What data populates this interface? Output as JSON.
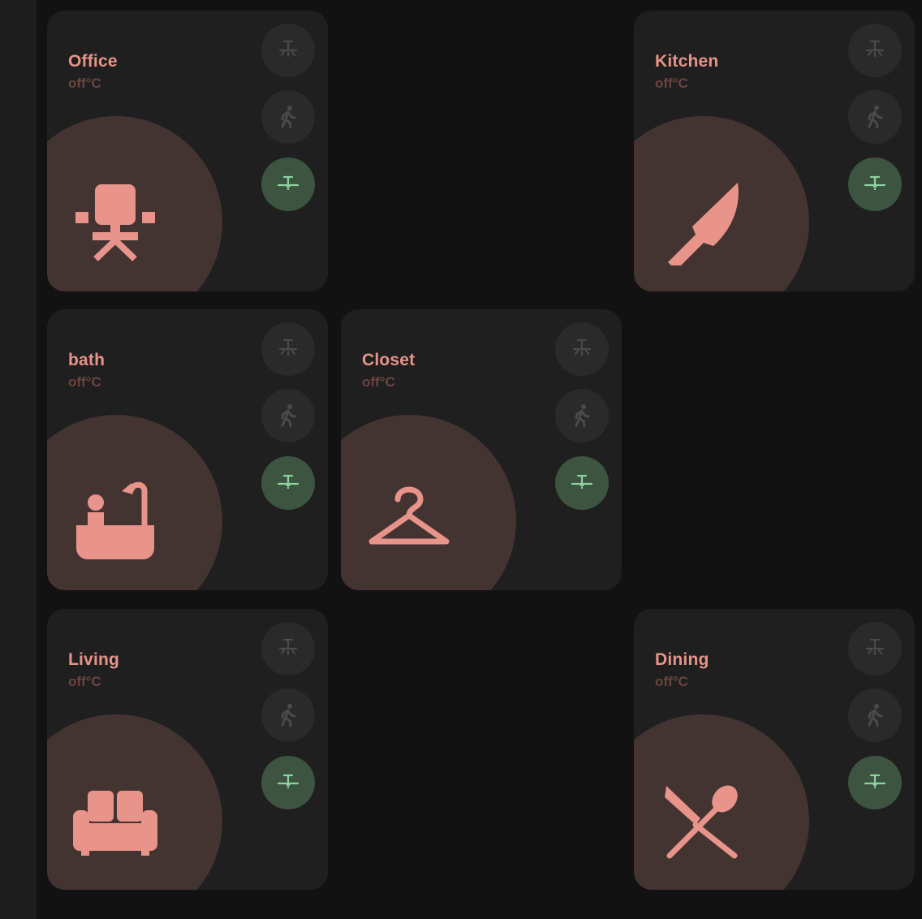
{
  "colors": {
    "accent": "#e8948a",
    "temp": "#6a4540",
    "card": "#1f1f1f",
    "blob": "#433432",
    "button_off": "#2a2a2a",
    "button_on": "#3c5440",
    "icon_on": "#8fd19e",
    "icon_off": "#4a4a4a"
  },
  "rooms": [
    {
      "name": "Office",
      "temp": "off°C",
      "icon": "office-chair-icon"
    },
    {
      "name": "Kitchen",
      "temp": "off°C",
      "icon": "knife-icon"
    },
    {
      "name": "bath",
      "temp": "off°C",
      "icon": "bathtub-icon"
    },
    {
      "name": "Closet",
      "temp": "off°C",
      "icon": "hanger-icon"
    },
    {
      "name": "Living",
      "temp": "off°C",
      "icon": "sofa-icon"
    },
    {
      "name": "Dining",
      "temp": "off°C",
      "icon": "silverware-icon"
    }
  ],
  "buttons": {
    "light": {
      "icon": "ceiling-light-icon",
      "state": "off"
    },
    "motion": {
      "icon": "walking-person-icon",
      "state": "off"
    },
    "fan": {
      "icon": "ceiling-fan-icon",
      "state": "on"
    }
  }
}
